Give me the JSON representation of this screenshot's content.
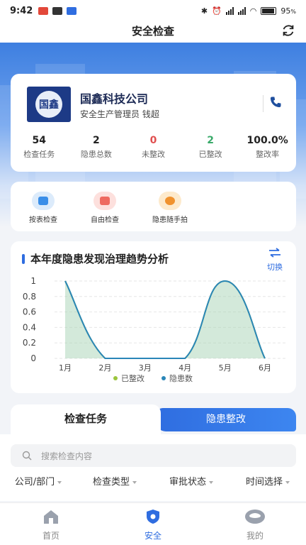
{
  "status_bar": {
    "time": "9:42",
    "battery": "95"
  },
  "header": {
    "title": "安全检查",
    "refresh_icon": "refresh-icon"
  },
  "company": {
    "logo_text": "国鑫",
    "name": "国鑫科技公司",
    "role": "安全生产管理员 钱超",
    "stats": [
      {
        "value": "54",
        "label": "检查任务",
        "color": "#222222"
      },
      {
        "value": "2",
        "label": "隐患总数",
        "color": "#222222"
      },
      {
        "value": "0",
        "label": "未整改",
        "color": "#e05050"
      },
      {
        "value": "2",
        "label": "已整改",
        "color": "#3aaa6a"
      },
      {
        "value": "100.0%",
        "label": "整改率",
        "color": "#222222"
      }
    ]
  },
  "quick_actions": [
    {
      "label": "按表检查",
      "icon": "checklist-icon",
      "bg": "#dcebfb",
      "fg": "#3a8ee8"
    },
    {
      "label": "自由检查",
      "icon": "shield-check-icon",
      "bg": "#fde0dd",
      "fg": "#ee6a60"
    },
    {
      "label": "隐患随手拍",
      "icon": "camera-icon",
      "bg": "#fdeacc",
      "fg": "#f0922e"
    }
  ],
  "trend": {
    "title": "本年度隐患发现治理趋势分析",
    "switch_label": "切换"
  },
  "chart_data": {
    "type": "line",
    "categories": [
      "1月",
      "2月",
      "3月",
      "4月",
      "5月",
      "6月"
    ],
    "ylim": [
      0,
      1
    ],
    "yticks": [
      "0",
      "0.2",
      "0.4",
      "0.6",
      "0.8",
      "1"
    ],
    "legend_position": "bottom",
    "series": [
      {
        "name": "已整改",
        "color": "#9bc53d",
        "values": [
          1,
          0,
          0,
          0,
          1,
          0
        ]
      },
      {
        "name": "隐患数",
        "color": "#2a86b8",
        "values": [
          1,
          0,
          0,
          0,
          1,
          0
        ]
      }
    ]
  },
  "tabs": {
    "active": "检查任务",
    "inactive": "隐患整改"
  },
  "search": {
    "placeholder": "搜索检查内容"
  },
  "filters": [
    "公司/部门",
    "检查类型",
    "审批状态",
    "时间选择"
  ],
  "bottom_nav": [
    {
      "label": "首页",
      "icon": "home-icon",
      "active": false
    },
    {
      "label": "安全",
      "icon": "safety-icon",
      "active": true
    },
    {
      "label": "我的",
      "icon": "profile-icon",
      "active": false
    }
  ]
}
